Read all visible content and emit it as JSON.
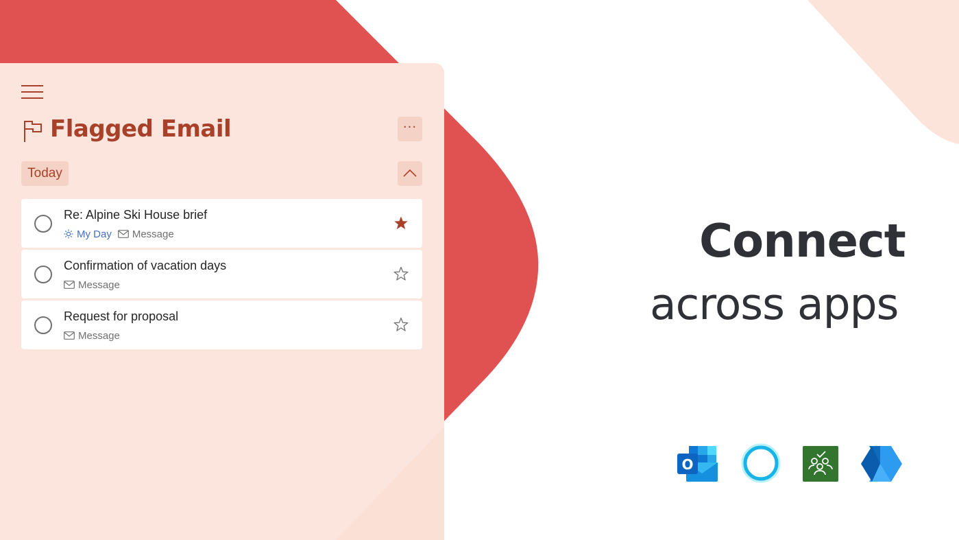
{
  "panel": {
    "title": "Flagged Email",
    "more_label": "···",
    "group_label": "Today"
  },
  "tasks": [
    {
      "name": "Re: Alpine Ski House brief",
      "my_day": "My Day",
      "source": "Message",
      "important": true
    },
    {
      "name": "Confirmation of vacation days",
      "source": "Message",
      "important": false
    },
    {
      "name": "Request for proposal",
      "source": "Message",
      "important": false
    }
  ],
  "promo": {
    "line1": "Connect",
    "line2": "across apps"
  },
  "apps": [
    {
      "icon": "outlook-icon",
      "label": "O"
    },
    {
      "icon": "cortana-icon"
    },
    {
      "icon": "planner-icon"
    },
    {
      "icon": "power-automate-icon"
    }
  ],
  "colors": {
    "accent": "#a8402a",
    "red_shape": "#e05251",
    "panel_bg": "#fce5dc",
    "my_day_blue": "#4270c8",
    "star_filled": "#a8402a"
  }
}
